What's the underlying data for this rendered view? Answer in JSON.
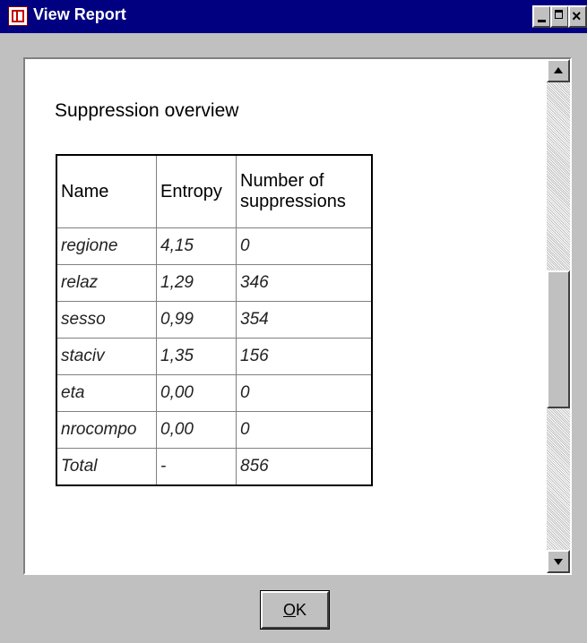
{
  "window": {
    "title": "View Report",
    "controls": {
      "minimize": "minimize-icon",
      "maximize": "maximize-icon",
      "close": "×"
    }
  },
  "report": {
    "section_title": "Suppression overview",
    "table": {
      "headers": [
        "Name",
        "Entropy",
        "Number of suppressions"
      ],
      "rows": [
        [
          "regione",
          "4,15",
          "0"
        ],
        [
          "relaz",
          "1,29",
          "346"
        ],
        [
          "sesso",
          "0,99",
          "354"
        ],
        [
          "staciv",
          "1,35",
          "156"
        ],
        [
          "eta",
          "0,00",
          "0"
        ],
        [
          "nrocompo",
          "0,00",
          "0"
        ],
        [
          "Total",
          "-",
          "856"
        ]
      ]
    }
  },
  "buttons": {
    "ok_mnemonic": "O",
    "ok_rest": "K"
  },
  "colors": {
    "titlebar": "#000080",
    "chrome": "#c0c0c0",
    "content": "#ffffff"
  }
}
